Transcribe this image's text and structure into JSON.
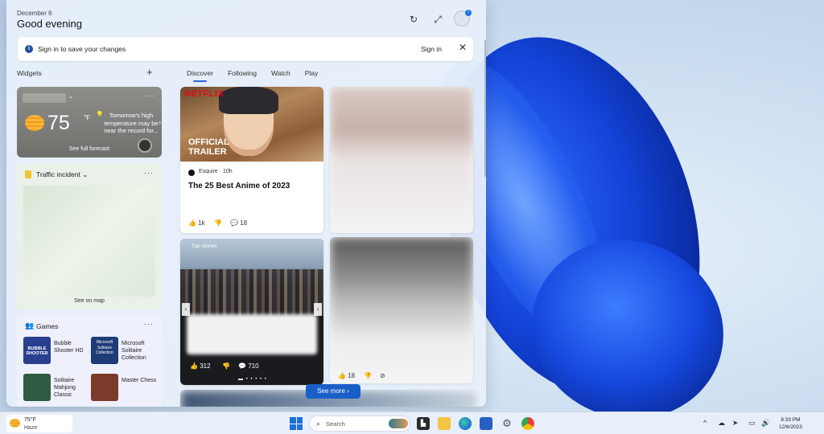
{
  "header": {
    "date": "December 6",
    "greeting": "Good evening",
    "refresh_icon": "↻",
    "expand_icon": "⤢",
    "avatar_badge": "!"
  },
  "signin_bar": {
    "info_icon": "i",
    "message": "Sign in to save your changes",
    "link": "Sign in",
    "close": "✕"
  },
  "widgets": {
    "label": "Widgets",
    "add": "+",
    "weather": {
      "temp": "75",
      "unit": "°F",
      "alert": "Tomorrow's high temperature may be near the record for...",
      "forecast_link": "See full forecast"
    },
    "traffic": {
      "title": "Traffic incident",
      "chevron": "⌄",
      "map_link": "See on map"
    },
    "games": {
      "title": "Games",
      "items": [
        {
          "name": "Bubble Shooter HD",
          "tile_text": "BUBBLE SHOOTER",
          "color": "#2a3f8f"
        },
        {
          "name": "Microsoft Solitaire Collection",
          "tile_text": "Microsoft Solitaire Collection",
          "color": "#1d3b77"
        },
        {
          "name": "Solitaire Mahjong Classic",
          "tile_text": "",
          "color": "#2f5a43"
        },
        {
          "name": "Master Chess",
          "tile_text": "",
          "color": "#7b3b2a"
        }
      ]
    }
  },
  "tabs": [
    "Discover",
    "Following",
    "Watch",
    "Play"
  ],
  "feed": {
    "anime": {
      "brand": "NETFLIX",
      "overlay": "OFFICIAL TRAILER",
      "source": "Esquire · 10h",
      "headline": "The 25 Best Anime of 2023",
      "likes": "1k",
      "comments": "18"
    },
    "story": {
      "label": "Top stories",
      "likes": "312",
      "comments": "710"
    },
    "card_b2": {
      "likes": "18"
    },
    "see_more": "See more"
  },
  "taskbar": {
    "weather_temp": "75°F",
    "weather_condition": "Haze",
    "search_placeholder": "Search",
    "time": "8:33 PM",
    "date": "12/6/2023"
  },
  "colors": {
    "accent": "#2b63d9",
    "netflix_red": "#e50914",
    "see_more_button": "#1a5fc8"
  }
}
